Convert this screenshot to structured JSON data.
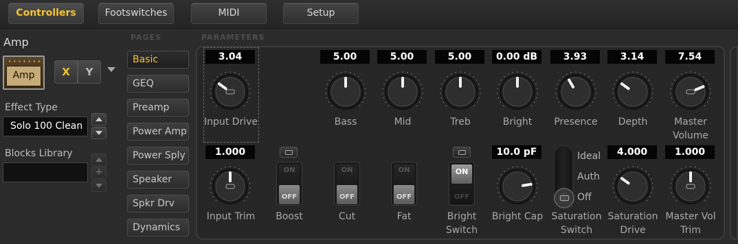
{
  "tabs": [
    {
      "label": "Controllers",
      "active": true
    },
    {
      "label": "Footswitches",
      "active": false
    },
    {
      "label": "MIDI",
      "active": false
    },
    {
      "label": "Setup",
      "active": false
    }
  ],
  "left": {
    "title": "Amp",
    "thumb_label": "Amp",
    "x_label": "X",
    "y_label": "Y",
    "effect_type_label": "Effect Type",
    "effect_type_value": "Solo 100 Clean",
    "blocks_library_label": "Blocks Library",
    "plus": "+"
  },
  "headers": {
    "pages": "PAGES",
    "parameters": "PARAMETERS"
  },
  "pages": [
    {
      "label": "Basic",
      "active": true
    },
    {
      "label": "GEQ",
      "active": false
    },
    {
      "label": "Preamp",
      "active": false
    },
    {
      "label": "Power Amp",
      "active": false
    },
    {
      "label": "Power Sply",
      "active": false
    },
    {
      "label": "Speaker",
      "active": false
    },
    {
      "label": "Spkr Drv",
      "active": false
    },
    {
      "label": "Dynamics",
      "active": false
    }
  ],
  "params_row1": [
    {
      "name": "Input Drive",
      "value": "3.04",
      "level": 0.3,
      "icon": "link-icon"
    },
    {
      "name": "Bass",
      "value": "5.00",
      "level": 0.5
    },
    {
      "name": "Mid",
      "value": "5.00",
      "level": 0.5
    },
    {
      "name": "Treb",
      "value": "5.00",
      "level": 0.5
    },
    {
      "name": "Bright",
      "value": "0.00 dB",
      "level": 0.5
    },
    {
      "name": "Presence",
      "value": "3.93",
      "level": 0.39
    },
    {
      "name": "Depth",
      "value": "3.14",
      "level": 0.3
    },
    {
      "name": "Master\nVolume",
      "value": "7.54",
      "level": 0.75,
      "icon": "link-icon"
    }
  ],
  "params_row2": {
    "input_trim": {
      "name": "Input Trim",
      "value": "1.000",
      "level": 0.5
    },
    "boost": {
      "name": "Boost",
      "on_label": "ON",
      "off_label": "OFF",
      "state": "off"
    },
    "cut": {
      "name": "Cut",
      "on_label": "ON",
      "off_label": "OFF",
      "state": "off"
    },
    "fat": {
      "name": "Fat",
      "on_label": "ON",
      "off_label": "OFF",
      "state": "off"
    },
    "bright_switch": {
      "name": "Bright\nSwitch",
      "on_label": "ON",
      "off_label": "OFF",
      "state": "on"
    },
    "bright_cap": {
      "name": "Bright Cap",
      "value": "10.0 pF",
      "level": 0.8
    },
    "saturation_switch": {
      "name": "Saturation\nSwitch",
      "options": [
        "Ideal",
        "Auth",
        "Off"
      ],
      "selected": "Off"
    },
    "saturation_drive": {
      "name": "Saturation\nDrive",
      "value": "4.000",
      "level": 0.3
    },
    "master_vol_trim": {
      "name": "Master Vol\nTrim",
      "value": "1.000",
      "level": 0.5
    }
  },
  "colors": {
    "accent": "#f3c233",
    "background": "#2b2b2b",
    "panel": "#262626"
  }
}
